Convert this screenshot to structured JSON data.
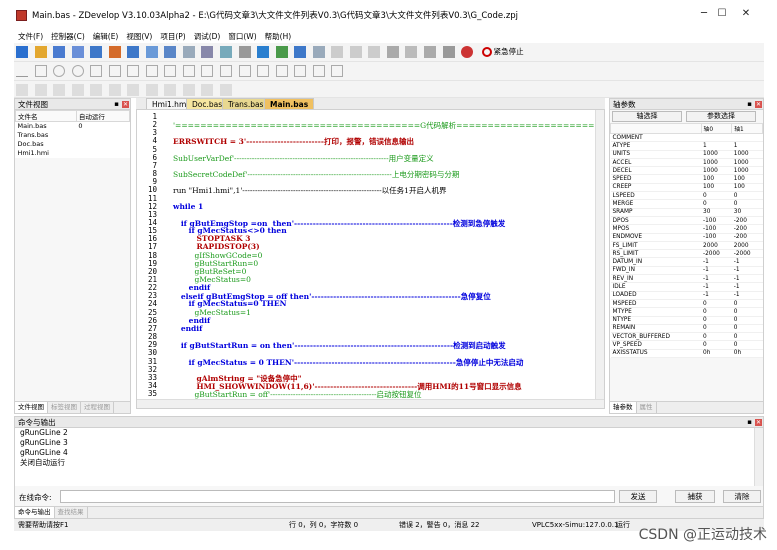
{
  "window": {
    "title": "Main.bas - ZDevelop V3.10.03Alpha2 - E:\\G代码文章3\\大文件文件列表V0.3\\G代码文章3\\大文件文件列表V0.3\\G_Code.zpj",
    "min": "─",
    "max": "☐",
    "close": "✕"
  },
  "menu": [
    "文件(F)",
    "控制器(C)",
    "编辑(E)",
    "视图(V)",
    "项目(P)",
    "调试(D)",
    "窗口(W)",
    "帮助(H)"
  ],
  "toolbar": {
    "estop": "紧急停止"
  },
  "file_view": {
    "title": "文件视图",
    "pin": "▪",
    "close": "✕",
    "col_name": "文件名",
    "col_auto": "自动运行",
    "files": [
      {
        "name": "Main.bas",
        "auto": "0"
      },
      {
        "name": "Trans.bas",
        "auto": ""
      },
      {
        "name": "Doc.bas",
        "auto": ""
      },
      {
        "name": "Hmi1.hmi",
        "auto": ""
      }
    ],
    "tabs": [
      "文件视图",
      "标签视图",
      "过程视图"
    ]
  },
  "editor": {
    "tabs": [
      "Hmi1.hmi",
      "Doc.bas",
      "Trans.bas",
      "Main.bas"
    ],
    "lines": [
      {
        "n": "1",
        "t": ""
      },
      {
        "n": "2",
        "t": "'=======================================G代码解析========================================"
      },
      {
        "n": "3",
        "t": ""
      },
      {
        "n": "4",
        "t": "ERRSWITCH = 3'-------------------------打印，报警，错误信息输出"
      },
      {
        "n": "5",
        "t": ""
      },
      {
        "n": "6",
        "t": "SubUserVarDef'-------------------------------------------------------------用户变量定义"
      },
      {
        "n": "7",
        "t": ""
      },
      {
        "n": "8",
        "t": "SubSecretCodeDef'---------------------------------------------------------上电分期密码与分期"
      },
      {
        "n": "9",
        "t": ""
      },
      {
        "n": "10",
        "t": "run \"Hmi1.hmi\",1'-------------------------------------------------------以任务1开启人机界"
      },
      {
        "n": "11",
        "t": ""
      },
      {
        "n": "12",
        "t": "while 1"
      },
      {
        "n": "13",
        "t": ""
      },
      {
        "n": "14",
        "t": "   if gButEmgStop =on  then'---------------------------------------------------检测到急停触发"
      },
      {
        "n": "15",
        "t": "      if gMecStatus<>0 then"
      },
      {
        "n": "16",
        "t": "         STOPTASK 3"
      },
      {
        "n": "17",
        "t": "         RAPIDSTOP(3)"
      },
      {
        "n": "18",
        "t": "         gIfShowGCode=0"
      },
      {
        "n": "19",
        "t": "         gButStartRun=0"
      },
      {
        "n": "20",
        "t": "         gButReSet=0"
      },
      {
        "n": "21",
        "t": "         gMecStatus=0"
      },
      {
        "n": "22",
        "t": "      endif"
      },
      {
        "n": "23",
        "t": "   elseif gButEmgStop = off then'------------------------------------------------急停复位"
      },
      {
        "n": "24",
        "t": "      if gMecStatus=0 THEN"
      },
      {
        "n": "25",
        "t": "         gMecStatus=1"
      },
      {
        "n": "26",
        "t": "      endif"
      },
      {
        "n": "27",
        "t": "   endif"
      },
      {
        "n": "28",
        "t": ""
      },
      {
        "n": "29",
        "t": "   if gButStartRun = on then'---------------------------------------------------检测到启动触发"
      },
      {
        "n": "30",
        "t": ""
      },
      {
        "n": "31",
        "t": "      if gMecStatus = 0 THEN'----------------------------------------------------急停停止中无法启动"
      },
      {
        "n": "32",
        "t": ""
      },
      {
        "n": "33",
        "t": "         gAlmString = \"设备急停中\""
      },
      {
        "n": "34",
        "t": "         HMI_SHOWWINDOW(11,6)'---------------------------------调用HMI的11号窗口显示信息"
      },
      {
        "n": "35",
        "t": "         gButStartRun = off'------------------------------------------启动按钮复位"
      }
    ]
  },
  "axis_panel": {
    "title": "轴参数",
    "pin": "▪",
    "close": "✕",
    "btn_axis": "轴选择",
    "btn_param": "参数选择",
    "col0": "轴0",
    "col1": "轴1",
    "rows": [
      [
        "COMMENT",
        "",
        ""
      ],
      [
        "ATYPE",
        "1",
        "1"
      ],
      [
        "UNITS",
        "1000",
        "1000"
      ],
      [
        "ACCEL",
        "1000",
        "1000"
      ],
      [
        "DECEL",
        "1000",
        "1000"
      ],
      [
        "SPEED",
        "100",
        "100"
      ],
      [
        "CREEP",
        "100",
        "100"
      ],
      [
        "LSPEED",
        "0",
        "0"
      ],
      [
        "MERGE",
        "0",
        "0"
      ],
      [
        "SRAMP",
        "30",
        "30"
      ],
      [
        "DPOS",
        "-100",
        "-200"
      ],
      [
        "MPOS",
        "-100",
        "-200"
      ],
      [
        "ENDMOVE",
        "-100",
        "-200"
      ],
      [
        "FS_LIMIT",
        "2000",
        "2000"
      ],
      [
        "RS_LIMIT",
        "-2000",
        "-2000"
      ],
      [
        "DATUM_IN",
        "-1",
        "-1"
      ],
      [
        "FWD_IN",
        "-1",
        "-1"
      ],
      [
        "REV_IN",
        "-1",
        "-1"
      ],
      [
        "IDLE",
        "-1",
        "-1"
      ],
      [
        "LOADED",
        "-1",
        "-1"
      ],
      [
        "MSPEED",
        "0",
        "0"
      ],
      [
        "MTYPE",
        "0",
        "0"
      ],
      [
        "NTYPE",
        "0",
        "0"
      ],
      [
        "REMAIN",
        "0",
        "0"
      ],
      [
        "VECTOR_BUFFERED",
        "0",
        "0"
      ],
      [
        "VP_SPEED",
        "0",
        "0"
      ],
      [
        "AXISSTATUS",
        "0h",
        "0h"
      ]
    ],
    "tabs": [
      "轴参数",
      "属性"
    ]
  },
  "output": {
    "title": "命令与输出",
    "pin": "▪",
    "close": "✕",
    "lines": [
      "gRunGLine   2",
      "gRunGLine   3",
      "gRunGLine   4",
      "关闭自动运行"
    ],
    "cmd_label": "在线命令:",
    "cmd_value": "",
    "send": "发送",
    "capture": "捕获",
    "clear": "清除",
    "tabs": [
      "命令与输出",
      "查找结果"
    ]
  },
  "status": {
    "help": "需要帮助请按F1",
    "pos": "行 0，列 0，字符数 0",
    "errors": "错误 2，警告 0，消息 22",
    "ctrl": "VPLC5xx-Simu:127.0.0.1",
    "state": "运行"
  },
  "watermark": "CSDN @正运动技术"
}
